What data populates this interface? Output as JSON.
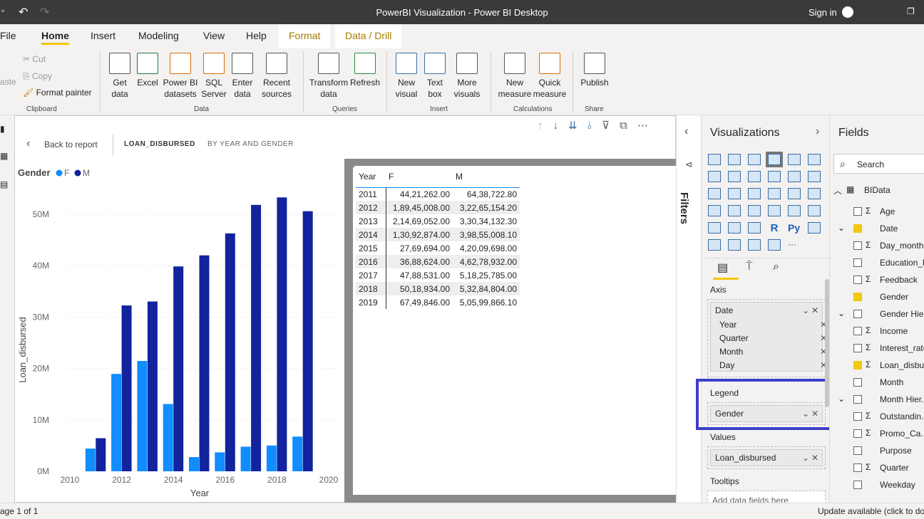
{
  "window": {
    "title": "PowerBI Visualization - Power BI Desktop",
    "sign_in": "Sign in"
  },
  "tabs": [
    "File",
    "Home",
    "Insert",
    "Modeling",
    "View",
    "Help",
    "Format",
    "Data / Drill"
  ],
  "ribbon": {
    "clipboard": {
      "paste": "aste",
      "cut": "Cut",
      "copy": "Copy",
      "format_painter": "Format painter",
      "group": "Clipboard"
    },
    "data": {
      "items": [
        "Get data",
        "Excel",
        "Power BI datasets",
        "SQL Server",
        "Enter data",
        "Recent sources"
      ],
      "group": "Data"
    },
    "queries": {
      "items": [
        "Transform data",
        "Refresh"
      ],
      "group": "Queries"
    },
    "insert": {
      "items": [
        "New visual",
        "Text box",
        "More visuals"
      ],
      "group": "Insert"
    },
    "calculations": {
      "items": [
        "New measure",
        "Quick measure"
      ],
      "group": "Calculations"
    },
    "share": {
      "items": [
        "Publish"
      ],
      "group": "Share"
    }
  },
  "drill": {
    "back": "Back to report",
    "field": "LOAN_DISBURSED",
    "subtitle": "BY YEAR AND GENDER"
  },
  "chart_data": {
    "type": "bar",
    "legend_title": "Gender",
    "legend_placement": "top-left",
    "xlabel": "Year",
    "ylabel": "Loan_disbursed",
    "x": [
      2011,
      2012,
      2013,
      2014,
      2015,
      2016,
      2017,
      2018,
      2019
    ],
    "xticks": [
      "2010",
      "2012",
      "2014",
      "2016",
      "2018",
      "2020"
    ],
    "yticks": [
      "0M",
      "10M",
      "20M",
      "30M",
      "40M",
      "50M"
    ],
    "ylim": [
      0,
      55000000
    ],
    "xlim": [
      2010,
      2020
    ],
    "grid": true,
    "series": [
      {
        "name": "F",
        "color": "#118dff",
        "values": [
          4421262,
          18945008,
          21469052,
          13092874,
          2769694,
          3688624,
          4788531,
          5018934,
          6749846
        ]
      },
      {
        "name": "M",
        "color": "#12239e",
        "values": [
          6438722.8,
          32265154.2,
          33034132.3,
          39855008.1,
          42009698,
          46278932,
          51825785,
          53284804,
          50599866.1
        ]
      }
    ]
  },
  "table": {
    "headers": [
      "Year",
      "F",
      "M"
    ],
    "rows": [
      [
        "2011",
        "44,21,262.00",
        "64,38,722.80"
      ],
      [
        "2012",
        "1,89,45,008.00",
        "3,22,65,154.20"
      ],
      [
        "2013",
        "2,14,69,052.00",
        "3,30,34,132.30"
      ],
      [
        "2014",
        "1,30,92,874.00",
        "3,98,55,008.10"
      ],
      [
        "2015",
        "27,69,694.00",
        "4,20,09,698.00"
      ],
      [
        "2016",
        "36,88,624.00",
        "4,62,78,932.00"
      ],
      [
        "2017",
        "47,88,531.00",
        "5,18,25,785.00"
      ],
      [
        "2018",
        "50,18,934.00",
        "5,32,84,804.00"
      ],
      [
        "2019",
        "67,49,846.00",
        "5,05,99,866.10"
      ]
    ]
  },
  "filters": {
    "label": "Filters"
  },
  "visualizations": {
    "title": "Visualizations",
    "axis_label": "Axis",
    "axis_field": "Date",
    "axis_sub": [
      "Year",
      "Quarter",
      "Month",
      "Day"
    ],
    "legend_label": "Legend",
    "legend_field": "Gender",
    "values_label": "Values",
    "values_field": "Loan_disbursed",
    "tooltips_label": "Tooltips",
    "tooltips_placeholder": "Add data fields here",
    "highlight_color": "#3c3fc8"
  },
  "fields": {
    "title": "Fields",
    "search_placeholder": "Search",
    "table": "BIData",
    "items": [
      {
        "name": "Age",
        "sigma": true,
        "checked": false
      },
      {
        "name": "Date",
        "sigma": false,
        "checked": true,
        "expand": true
      },
      {
        "name": "Day_month",
        "sigma": true,
        "checked": false
      },
      {
        "name": "Education_l...",
        "sigma": false,
        "checked": false
      },
      {
        "name": "Feedback",
        "sigma": true,
        "checked": false
      },
      {
        "name": "Gender",
        "sigma": false,
        "checked": true
      },
      {
        "name": "Gender Hie...",
        "sigma": false,
        "checked": false,
        "expand": true
      },
      {
        "name": "Income",
        "sigma": true,
        "checked": false
      },
      {
        "name": "Interest_rate",
        "sigma": true,
        "checked": false
      },
      {
        "name": "Loan_disbu...",
        "sigma": true,
        "checked": true
      },
      {
        "name": "Month",
        "sigma": false,
        "checked": false
      },
      {
        "name": "Month Hier...",
        "sigma": false,
        "checked": false,
        "expand": true
      },
      {
        "name": "Outstandin...",
        "sigma": true,
        "checked": false
      },
      {
        "name": "Promo_Ca...",
        "sigma": true,
        "checked": false
      },
      {
        "name": "Purpose",
        "sigma": false,
        "checked": false
      },
      {
        "name": "Quarter",
        "sigma": true,
        "checked": false
      },
      {
        "name": "Weekday",
        "sigma": false,
        "checked": false
      }
    ]
  },
  "status": {
    "page": "age 1 of 1",
    "update": "Update available (click to do"
  }
}
